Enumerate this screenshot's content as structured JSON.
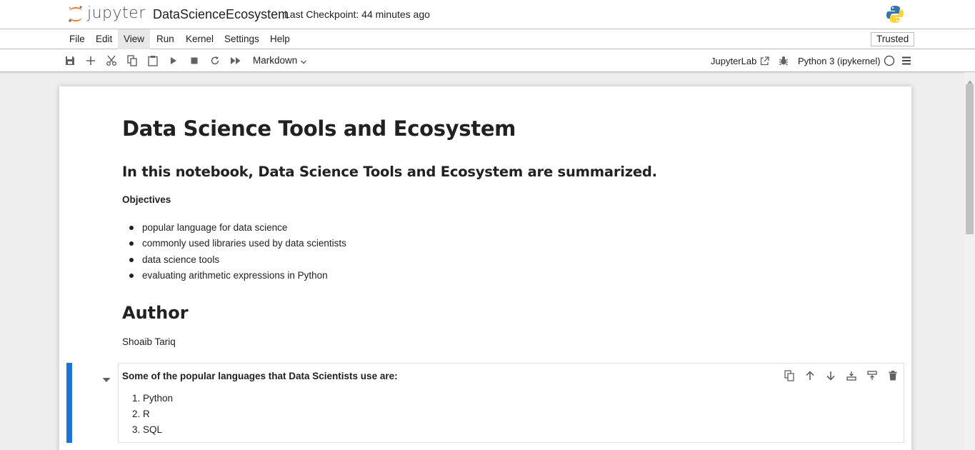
{
  "header": {
    "logo_text": "jupyter",
    "notebook_title": "DataScienceEcosystem",
    "checkpoint": "Last Checkpoint: 44 minutes ago"
  },
  "menubar": {
    "items": [
      "File",
      "Edit",
      "View",
      "Run",
      "Kernel",
      "Settings",
      "Help"
    ],
    "active": "View",
    "trusted": "Trusted"
  },
  "toolbar": {
    "cell_type": "Markdown",
    "jupyterlab_link": "JupyterLab",
    "kernel": "Python 3 (ipykernel)",
    "icons": [
      "save-icon",
      "add-icon",
      "cut-icon",
      "copy-icon",
      "paste-icon",
      "run-icon",
      "stop-icon",
      "restart-icon",
      "fast-forward-icon"
    ]
  },
  "notebook": {
    "title": "Data Science Tools and Ecosystem",
    "subtitle": "In this notebook, Data Science Tools and Ecosystem are summarized.",
    "objectives_label": "Objectives",
    "objectives": [
      "popular language for data science",
      "commonly used libraries used by data scientists",
      "data science tools",
      "evaluating arithmetic expressions in Python"
    ],
    "author_heading": "Author",
    "author_name": "Shoaib Tariq",
    "active_cell": {
      "heading": "Some of the popular languages that Data Scientists use are:",
      "languages": [
        "1. Python",
        "2. R",
        "3. SQL"
      ]
    }
  },
  "colors": {
    "active_cell_bar": "#1976d2",
    "jupyter_orange": "#f37726"
  }
}
